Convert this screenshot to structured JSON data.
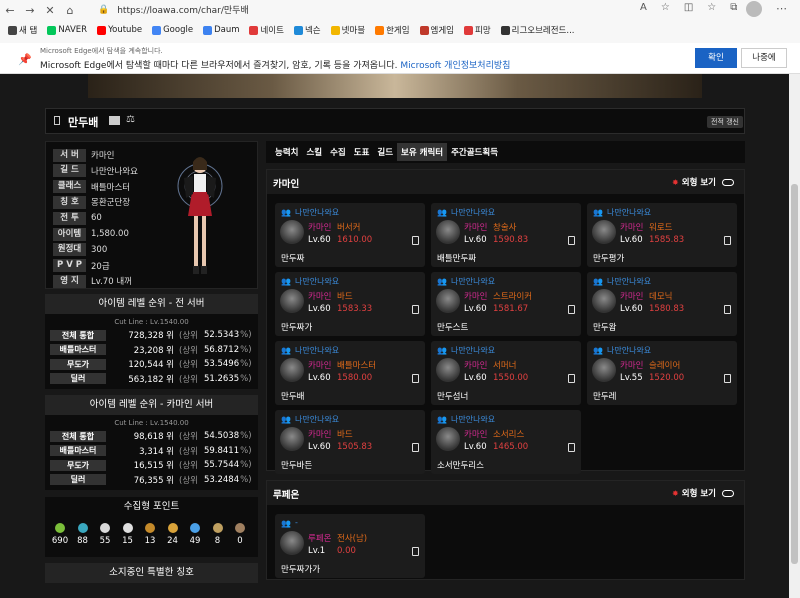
{
  "browser": {
    "url": "https://loawa.com/char/만두배",
    "bookmarks": [
      {
        "label": "새 탭",
        "color": "#444"
      },
      {
        "label": "NAVER",
        "color": "#03c75a"
      },
      {
        "label": "Youtube",
        "color": "#ff0000"
      },
      {
        "label": "Google",
        "color": "#4285f4"
      },
      {
        "label": "Daum",
        "color": "#3d82f0"
      },
      {
        "label": "네이트",
        "color": "#e03a3a"
      },
      {
        "label": "넥슨",
        "color": "#1f8ad8"
      },
      {
        "label": "넷마블",
        "color": "#f2b600"
      },
      {
        "label": "한게임",
        "color": "#ff7a00"
      },
      {
        "label": "엠게임",
        "color": "#c0392b"
      },
      {
        "label": "피망",
        "color": "#e03a3a"
      },
      {
        "label": "리그오브레전드...",
        "color": "#333"
      }
    ]
  },
  "notice": {
    "line1": "Microsoft Edge에서 탐색을 계속합니다.",
    "line2": "Microsoft Edge에서 탐색할 때마다 다른 브라우저에서 즐겨찾기, 암호, 기록 등을 가져옵니다.",
    "link": "Microsoft 개인정보처리방침",
    "confirm": "확인",
    "later": "나중에"
  },
  "header": {
    "name": "만두배",
    "refresh": "전적 갱신"
  },
  "profile": {
    "rows": [
      {
        "label": "서 버",
        "value": "카마인"
      },
      {
        "label": "길 드",
        "value": "나만안나와요"
      },
      {
        "label": "클래스",
        "value": "배틀마스터"
      },
      {
        "label": "칭 호",
        "value": "몽환군단장"
      },
      {
        "label": "전 투",
        "value": "60"
      },
      {
        "label": "아이템",
        "value": "1,580.00"
      },
      {
        "label": "원정대",
        "value": "300"
      },
      {
        "label": "P V P",
        "value": "20급"
      },
      {
        "label": "영 지",
        "value": "Lv.70 내꺼"
      }
    ]
  },
  "rank_all": {
    "title": "아이템 레벨 순위 - 전 서버",
    "cutline": "Cut Line : Lv.1540.00",
    "rows": [
      {
        "label": "전체 통합",
        "value": "728,328 위",
        "pre": "(상위",
        "pct": "52.5343",
        "post": "%)"
      },
      {
        "label": "배틀마스터",
        "value": "23,208 위",
        "pre": "(상위",
        "pct": "56.8712",
        "post": "%)"
      },
      {
        "label": "무도가",
        "value": "120,544 위",
        "pre": "(상위",
        "pct": "53.5496",
        "post": "%)"
      },
      {
        "label": "딜러",
        "value": "563,182 위",
        "pre": "(상위",
        "pct": "51.2635",
        "post": "%)"
      }
    ]
  },
  "rank_server": {
    "title": "아이템 레벨 순위 - 카마인 서버",
    "cutline": "Cut Line : Lv.1540.00",
    "rows": [
      {
        "label": "전체 통합",
        "value": "98,618 위",
        "pre": "(상위",
        "pct": "54.5038",
        "post": "%)"
      },
      {
        "label": "배틀마스터",
        "value": "3,314 위",
        "pre": "(상위",
        "pct": "59.8411",
        "post": "%)"
      },
      {
        "label": "무도가",
        "value": "16,515 위",
        "pre": "(상위",
        "pct": "55.7544",
        "post": "%)"
      },
      {
        "label": "딜러",
        "value": "76,355 위",
        "pre": "(상위",
        "pct": "53.2484",
        "post": "%)"
      }
    ]
  },
  "collect": {
    "title": "수집형 포인트",
    "items": [
      {
        "icon": "seed-icon",
        "value": "690",
        "color": "#7bbf3a"
      },
      {
        "icon": "island-icon",
        "value": "88",
        "color": "#3aa8bf"
      },
      {
        "icon": "heart-icon",
        "value": "55",
        "color": "#d9d9d9"
      },
      {
        "icon": "mokoko-icon",
        "value": "15",
        "color": "#e0e0e0"
      },
      {
        "icon": "art-icon",
        "value": "13",
        "color": "#c48a2a"
      },
      {
        "icon": "voyage-icon",
        "value": "24",
        "color": "#d9a33a"
      },
      {
        "icon": "star-icon",
        "value": "49",
        "color": "#4aa0e8"
      },
      {
        "icon": "medal-icon",
        "value": "8",
        "color": "#bfa060"
      },
      {
        "icon": "orpheus-icon",
        "value": "0",
        "color": "#a08060"
      }
    ]
  },
  "titles_section": "소지중인 특별한 칭호",
  "tabs": [
    "능력치",
    "스킬",
    "수집",
    "도표",
    "길드",
    "보유 캐릭터",
    "주간골드획득"
  ],
  "active_tab": 5,
  "external_view": "외형 보기",
  "servers": [
    {
      "name": "카마인",
      "cards": [
        {
          "guild": "나만안나와요",
          "server": "카마인",
          "cls": "버서커",
          "lv": "Lv.60",
          "ilvl": "1610.00",
          "name": "만두짜"
        },
        {
          "guild": "나만안나와요",
          "server": "카마인",
          "cls": "창술사",
          "lv": "Lv.60",
          "ilvl": "1590.83",
          "name": "배틀만두짜"
        },
        {
          "guild": "나만안나와요",
          "server": "카마인",
          "cls": "워로드",
          "lv": "Lv.60",
          "ilvl": "1585.83",
          "name": "만두평가"
        },
        {
          "guild": "나만안나와요",
          "server": "카마인",
          "cls": "바드",
          "lv": "Lv.60",
          "ilvl": "1583.33",
          "name": "만두짜가"
        },
        {
          "guild": "나만안나와요",
          "server": "카마인",
          "cls": "스트라이커",
          "lv": "Lv.60",
          "ilvl": "1581.67",
          "name": "만두스트"
        },
        {
          "guild": "나만안나와요",
          "server": "카마인",
          "cls": "데모닉",
          "lv": "Lv.60",
          "ilvl": "1580.83",
          "name": "만두왐"
        },
        {
          "guild": "나만안나와요",
          "server": "카마인",
          "cls": "배틀마스터",
          "lv": "Lv.60",
          "ilvl": "1580.00",
          "name": "만두배"
        },
        {
          "guild": "나만안나와요",
          "server": "카마인",
          "cls": "서머너",
          "lv": "Lv.60",
          "ilvl": "1550.00",
          "name": "만두섬너"
        },
        {
          "guild": "나만안나와요",
          "server": "카마인",
          "cls": "슬레이어",
          "lv": "Lv.55",
          "ilvl": "1520.00",
          "name": "만두레"
        },
        {
          "guild": "나만안나와요",
          "server": "카마인",
          "cls": "바드",
          "lv": "Lv.60",
          "ilvl": "1505.83",
          "name": "만두바든"
        },
        {
          "guild": "나만안나와요",
          "server": "카마인",
          "cls": "소서리스",
          "lv": "Lv.60",
          "ilvl": "1465.00",
          "name": "소서만두리스"
        }
      ]
    },
    {
      "name": "루페온",
      "cards": [
        {
          "guild": "-",
          "server": "루페온",
          "cls": "전사(남)",
          "lv": "Lv.1",
          "ilvl": "0.00",
          "name": "만두짜가가"
        }
      ]
    }
  ]
}
